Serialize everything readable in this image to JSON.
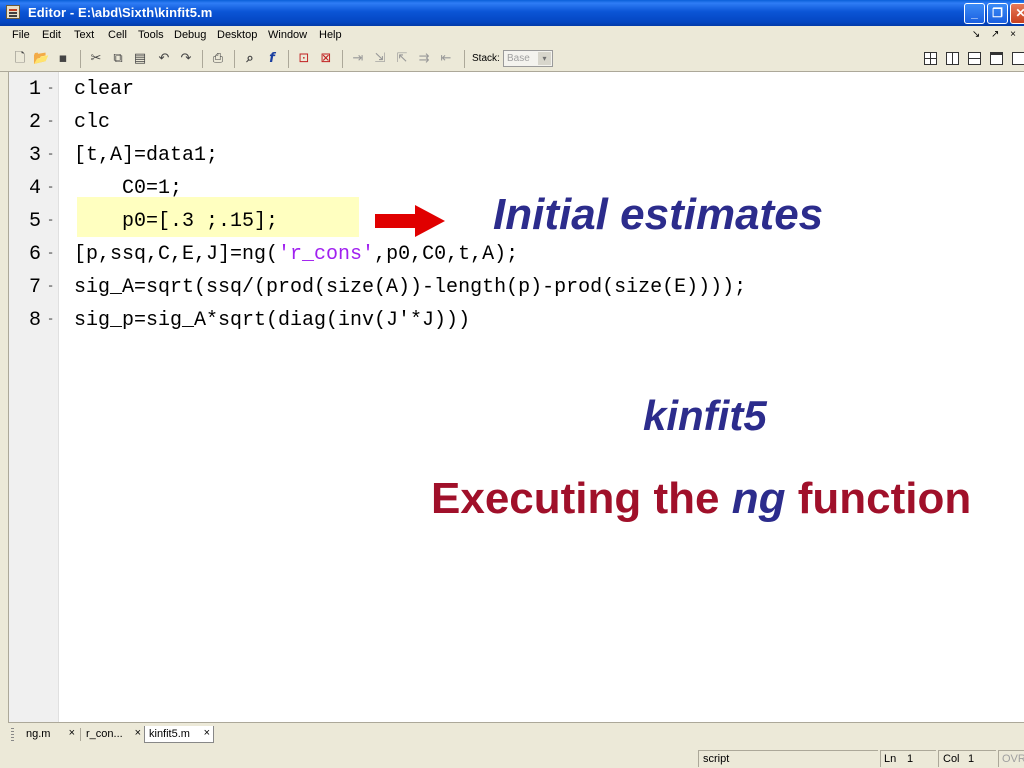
{
  "window": {
    "title": "Editor - E:\\abd\\Sixth\\kinfit5.m",
    "min_glyph": "_",
    "max_glyph": "❐",
    "close_glyph": "✕"
  },
  "menu": {
    "items": [
      "File",
      "Edit",
      "Text",
      "Cell",
      "Tools",
      "Debug",
      "Desktop",
      "Window",
      "Help"
    ],
    "dock_arrows": "↘ ↗ ×"
  },
  "toolbar": {
    "stack_label": "Stack:",
    "stack_value": "Base",
    "stack_arrow": "▾",
    "icons": [
      "new-file-icon",
      "open-folder-icon",
      "save-icon",
      "cut-icon",
      "copy-icon",
      "paste-icon",
      "undo-icon",
      "redo-icon",
      "print-icon",
      "find-icon",
      "function-icon",
      "clear-breakpoint-icon",
      "stop-icon",
      "step-icon",
      "step-in-icon",
      "step-out-icon",
      "continue-icon",
      "exit-debug-icon"
    ]
  },
  "editor": {
    "lines": [
      {
        "num": "1",
        "dash": "-",
        "code": "clear"
      },
      {
        "num": "2",
        "dash": "-",
        "code": "clc"
      },
      {
        "num": "3",
        "dash": "-",
        "code": "[t,A]=data1;"
      },
      {
        "num": "4",
        "dash": "-",
        "code": "    C0=1;"
      },
      {
        "num": "5",
        "dash": "-",
        "code": "    p0=[.3 ;.15];"
      },
      {
        "num": "6",
        "dash": "-",
        "code_before": "[p,ssq,C,E,J]=ng(",
        "code_str": "'r_cons'",
        "code_after": ",p0,C0,t,A);"
      },
      {
        "num": "7",
        "dash": "-",
        "code": "sig_A=sqrt(ssq/(prod(size(A))-length(p)-prod(size(E))));"
      },
      {
        "num": "8",
        "dash": "-",
        "code": "sig_p=sig_A*sqrt(diag(inv(J'*J)))"
      }
    ],
    "annotation_initial": "Initial estimates",
    "annotation_kinfit": "kinfit5",
    "annotation_exec_before": "Executing the ",
    "annotation_exec_ng": "ng",
    "annotation_exec_after": " function",
    "colors": {
      "string": "#a020f0",
      "highlight": "#ffffc0",
      "arrow": "#e00000",
      "blue_annotation": "#2c2c8c",
      "red_annotation": "#a0102a"
    }
  },
  "tabs": [
    {
      "label": "ng.m",
      "close": "×"
    },
    {
      "label": "r_con...",
      "close": "×"
    },
    {
      "label": "kinfit5.m",
      "close": "×"
    }
  ],
  "status": {
    "mode": "script",
    "ln_label": "Ln",
    "ln_value": "1",
    "col_label": "Col",
    "col_value": "1",
    "ovr": "OVR"
  }
}
